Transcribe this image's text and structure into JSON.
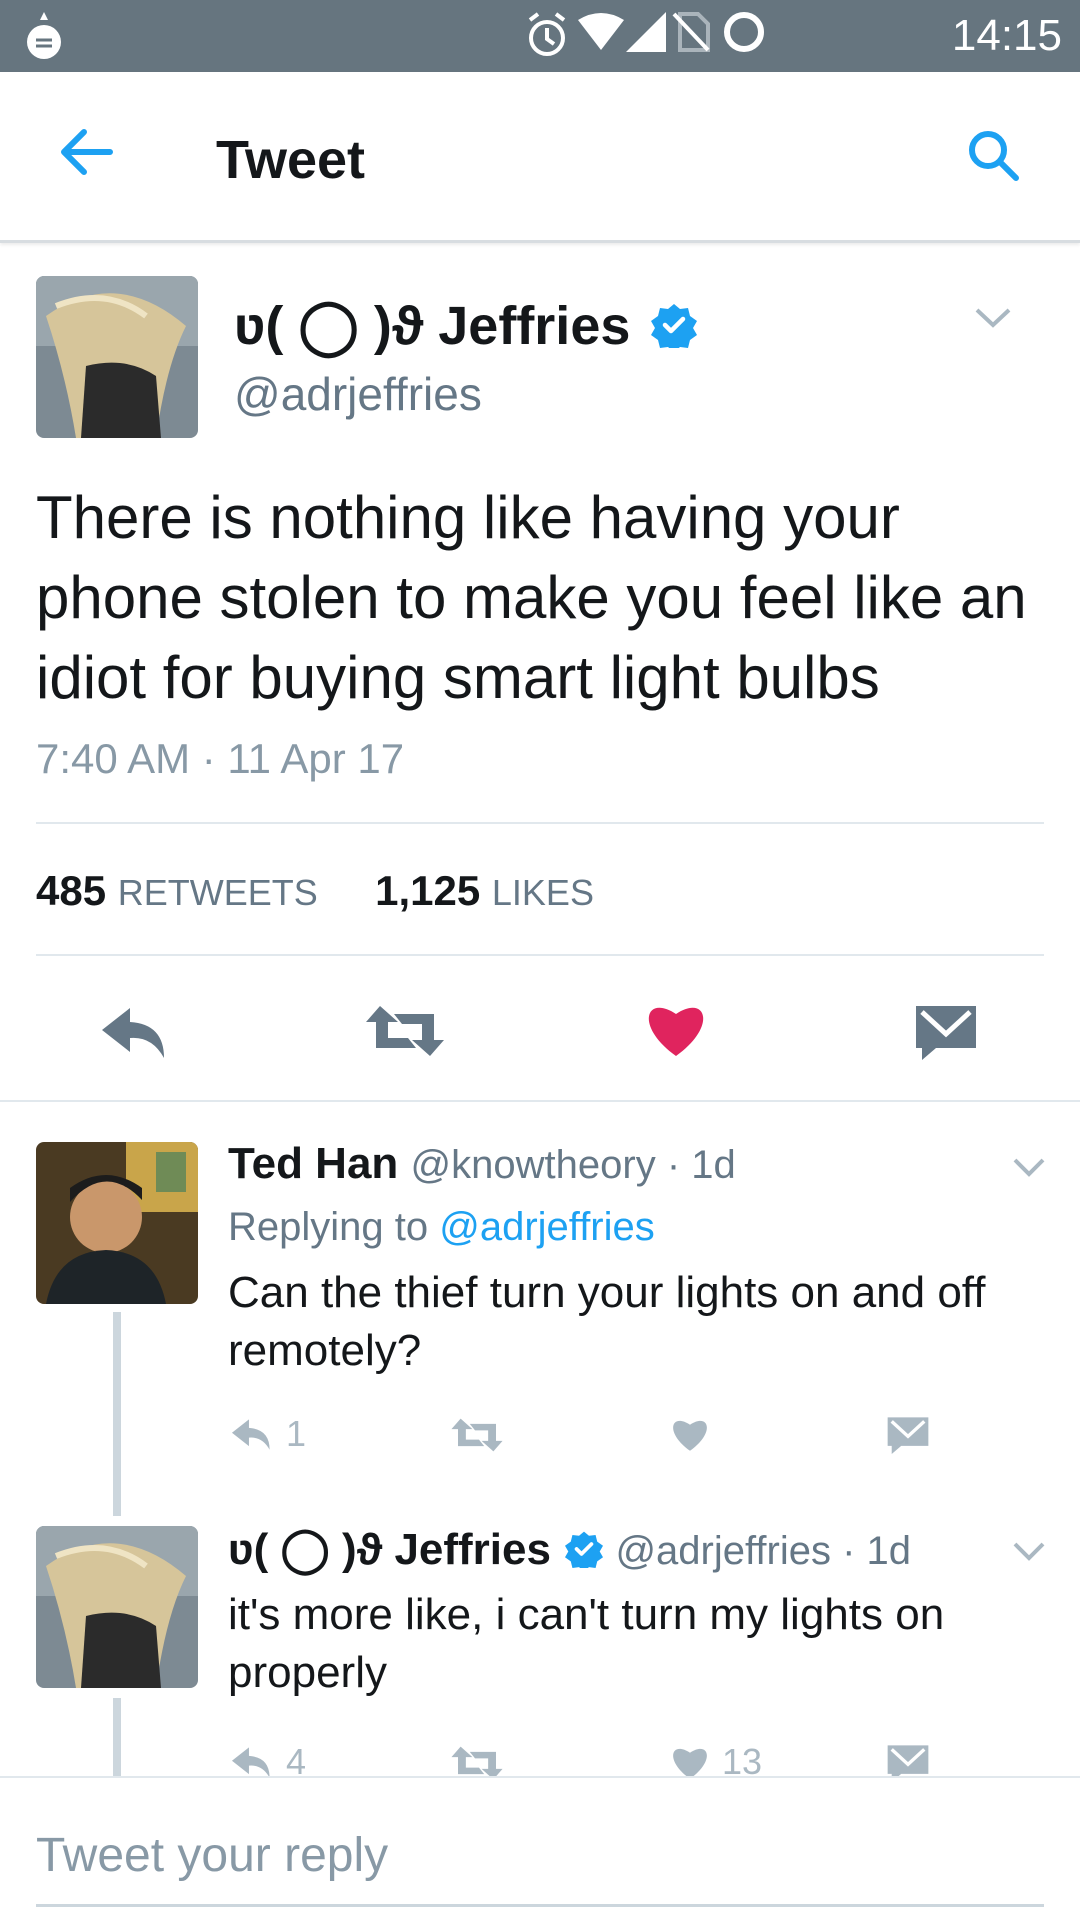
{
  "status_bar": {
    "time": "14:15"
  },
  "app_bar": {
    "title": "Tweet"
  },
  "main_tweet": {
    "author_name": "ʋ( ◯ )ϑ Jeffries",
    "handle": "@adrjeffries",
    "text": "There is nothing like having your phone stolen to make you feel like an idiot for buying smart light bulbs",
    "timestamp": "7:40 AM · 11 Apr 17",
    "retweets": "485",
    "retweets_label": "RETWEETS",
    "likes": "1,125",
    "likes_label": "LIKES",
    "liked": true
  },
  "replies": [
    {
      "author_name": "Ted Han",
      "handle_time": "@knowtheory · 1d",
      "replying_prefix": "Replying to",
      "replying_handle": "@adrjeffries",
      "text": "Can the thief turn your lights on and off remotely?",
      "reply_count": "1",
      "like_count": ""
    },
    {
      "author_name": "ʋ( ◯ )ϑ Jeffries",
      "handle_time": "@adrjeffries · 1d",
      "text": "it's more like, i can't turn my lights on properly",
      "reply_count": "4",
      "like_count": "13"
    }
  ],
  "composer": {
    "placeholder": "Tweet your reply"
  },
  "colors": {
    "accent": "#1da1f2",
    "like": "#e0245e",
    "status_bar": "#66757f",
    "muted": "#657786"
  }
}
